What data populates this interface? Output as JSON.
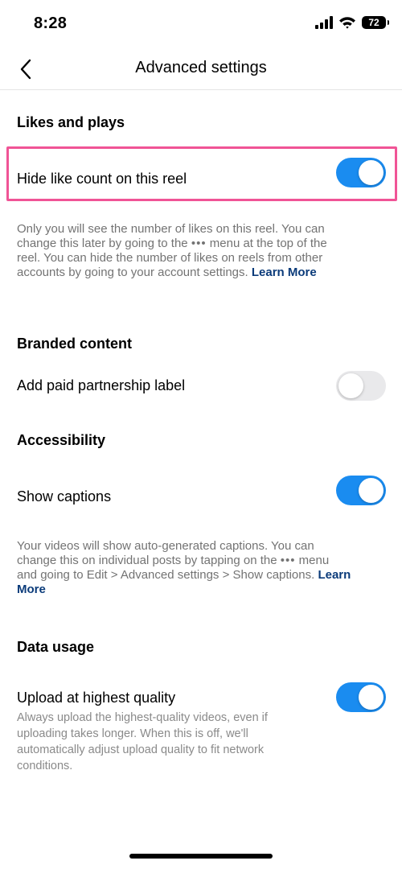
{
  "status_bar": {
    "time": "8:28",
    "battery": "72"
  },
  "nav": {
    "title": "Advanced settings"
  },
  "likes": {
    "section_title": "Likes and plays",
    "hide_like_label": "Hide like count on this reel",
    "hide_like_on": true,
    "desc_line1": "Only you will see the number of likes on this reel. You can",
    "desc_line2_a": "change this later by going to the",
    "desc_line2_b": "menu at the top of the",
    "desc_line3": "reel. You can hide the number of likes on reels from other",
    "desc_line4": "accounts by going to your account settings.",
    "learn_more": "Learn More"
  },
  "branded": {
    "section_title": "Branded content",
    "paid_label": "Add paid partnership label",
    "paid_on": false
  },
  "accessibility": {
    "section_title": "Accessibility",
    "captions_label": "Show captions",
    "captions_on": true,
    "desc_line1": "Your videos will show auto-generated captions. You can",
    "desc_line2_a": "change this on individual posts by tapping on the",
    "desc_line2_b": "menu",
    "desc_line3": "and going to Edit > Advanced settings > Show captions.",
    "learn_a": "Learn",
    "learn_b": "More"
  },
  "data_usage": {
    "section_title": "Data usage",
    "upload_label": "Upload at highest quality",
    "upload_on": true,
    "desc_line1": "Always upload the highest-quality videos, even if",
    "desc_line2": "uploading takes longer. When this is off, we'll",
    "desc_line3": "automatically adjust upload quality to fit network",
    "desc_line4": "conditions."
  },
  "colors": {
    "toggle_on": "#1a8cf0",
    "toggle_off": "#e9e9eb",
    "highlight": "#f05496",
    "link": "#0b3b7a"
  }
}
